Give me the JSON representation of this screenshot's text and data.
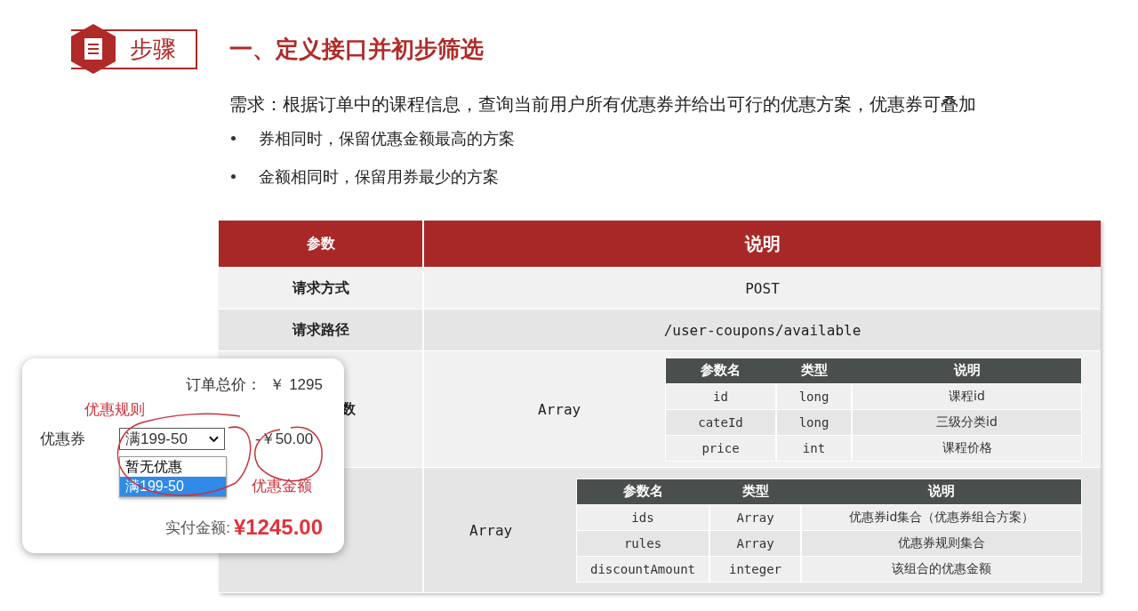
{
  "header": {
    "badge": "步骤",
    "title": "一、定义接口并初步筛选"
  },
  "requirement": "需求：根据订单中的课程信息，查询当前用户所有优惠券并给出可行的优惠方案，优惠券可叠加",
  "bullets": [
    "券相同时，保留优惠金额最高的方案",
    "金额相同时，保留用券最少的方案"
  ],
  "table": {
    "columns": [
      "参数",
      "说明"
    ],
    "rows": [
      {
        "kind": "text",
        "label": "请求方式",
        "value": "POST"
      },
      {
        "kind": "text",
        "label": "请求路径",
        "value": "/user-coupons/available"
      },
      {
        "kind": "nested",
        "label": "数",
        "value": "Array",
        "sub_table": {
          "columns": [
            "参数名",
            "类型",
            "说明"
          ],
          "rows": [
            [
              "id",
              "long",
              "课程id"
            ],
            [
              "cateId",
              "long",
              "三级分类id"
            ],
            [
              "price",
              "int",
              "课程价格"
            ]
          ]
        }
      },
      {
        "kind": "nested",
        "value": "Array",
        "sub_table": {
          "columns": [
            "参数名",
            "类型",
            "说明"
          ],
          "rows": [
            [
              "ids",
              "Array",
              "优惠券id集合（优惠券组合方案）"
            ],
            [
              "rules",
              "Array",
              "优惠券规则集合"
            ],
            [
              "discountAmount",
              "integer",
              "该组合的优惠金额"
            ]
          ]
        }
      }
    ]
  },
  "order_card": {
    "total_label": "订单总价：",
    "total": "￥ 1295",
    "coupon_label": "优惠券",
    "select_value": "满199-50",
    "options": [
      {
        "label": "暂无优惠",
        "selected": false
      },
      {
        "label": "满199-50",
        "selected": true
      }
    ],
    "discount": "-￥50.00",
    "pay_label": "实付金额:",
    "pay": "¥1245.00",
    "annotations": [
      "优惠规则",
      "优惠金额"
    ]
  }
}
